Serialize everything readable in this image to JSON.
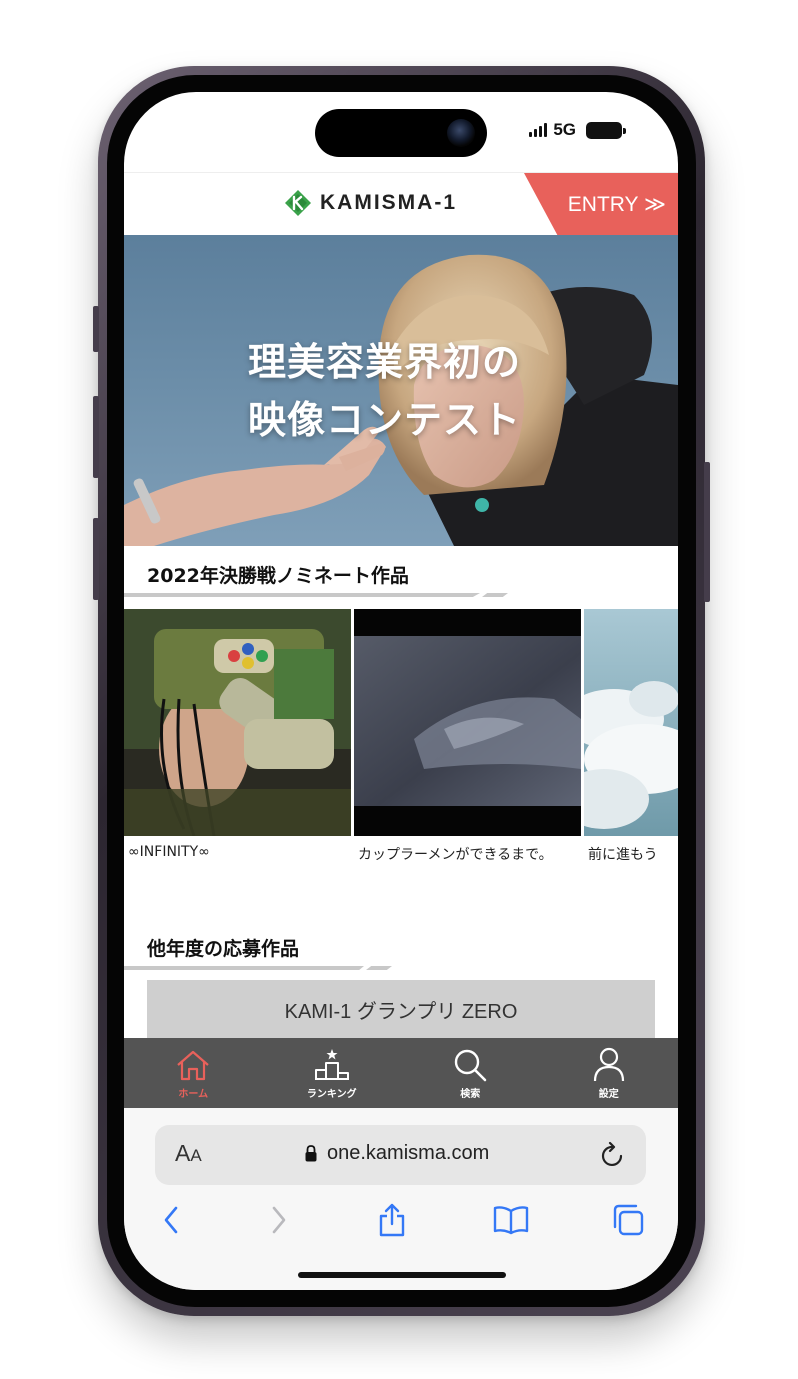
{
  "status_bar": {
    "network": "5G"
  },
  "header": {
    "logo_text": "KAMISMA-1",
    "entry_label": "ENTRY ≫"
  },
  "hero": {
    "title_line1": "理美容業界初の",
    "title_line2": "映像コンテスト"
  },
  "nominees": {
    "heading": "2022年決勝戦ノミネート作品",
    "items": [
      {
        "title": "∞INFINITY∞"
      },
      {
        "title": "カップラーメンができるまで。"
      },
      {
        "title": "前に進もう"
      }
    ]
  },
  "other_years": {
    "heading": "他年度の応募作品",
    "button_label": "KAMI-1 グランプリ ZERO"
  },
  "tabbar": {
    "items": [
      {
        "label": "ホーム",
        "icon": "home-icon",
        "active": true
      },
      {
        "label": "ランキング",
        "icon": "podium-icon",
        "active": false
      },
      {
        "label": "検索",
        "icon": "search-icon",
        "active": false
      },
      {
        "label": "設定",
        "icon": "person-icon",
        "active": false
      }
    ]
  },
  "browser": {
    "aa_big": "A",
    "aa_small": "A",
    "url": "one.kamisma.com"
  },
  "colors": {
    "accent": "#e8615b",
    "tabbar": "#545454",
    "safari_blue": "#3478f6"
  }
}
